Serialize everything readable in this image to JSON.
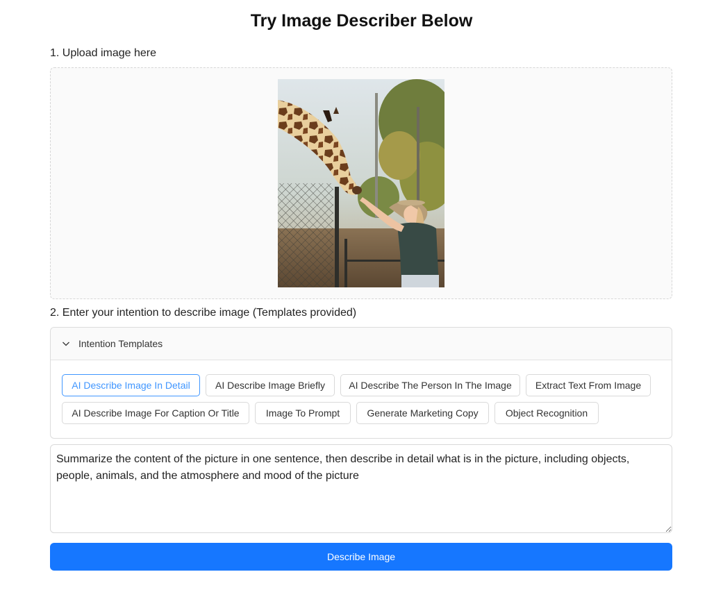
{
  "page": {
    "title": "Try Image Describer Below"
  },
  "upload": {
    "label": "1. Upload image here",
    "preview_icon": "uploaded-photo-giraffe-feeding"
  },
  "intention": {
    "label": "2. Enter your intention to describe image (Templates provided)",
    "panel_title": "Intention Templates",
    "panel_icon": "chevron-down-icon",
    "templates": [
      {
        "label": "AI Describe Image In Detail",
        "selected": true
      },
      {
        "label": "AI Describe Image Briefly",
        "selected": false
      },
      {
        "label": "AI Describe The Person In The Image",
        "selected": false
      },
      {
        "label": "Extract Text From Image",
        "selected": false
      },
      {
        "label": "AI Describe Image For Caption Or Title",
        "selected": false
      },
      {
        "label": "Image To Prompt",
        "selected": false
      },
      {
        "label": "Generate Marketing Copy",
        "selected": false
      },
      {
        "label": "Object Recognition",
        "selected": false
      }
    ],
    "prompt_value": "Summarize the content of the picture in one sentence, then describe in detail what is in the picture, including objects, people, animals, and the atmosphere and mood of the picture"
  },
  "actions": {
    "describe_label": "Describe Image"
  },
  "colors": {
    "accent": "#1677ff",
    "selected_border": "#4096ff",
    "border": "#d9d9d9",
    "panel_header_bg": "#fafafa"
  }
}
